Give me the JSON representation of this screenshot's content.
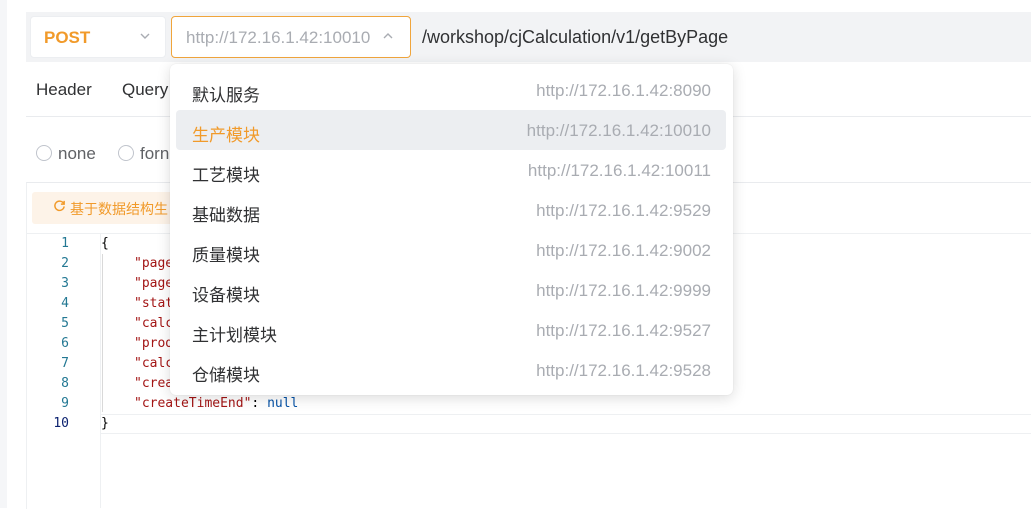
{
  "request": {
    "method": "POST",
    "server_url": "http://172.16.1.42:10010",
    "path": "/workshop/cjCalculation/v1/getByPage"
  },
  "tabs": [
    "Header",
    "Query"
  ],
  "body_types": [
    "none",
    "forn"
  ],
  "editor": {
    "generate_button": "基于数据结构生",
    "line_numbers": [
      "1",
      "2",
      "3",
      "4",
      "5",
      "6",
      "7",
      "8",
      "9",
      "10"
    ],
    "lines": [
      {
        "text": "{"
      },
      {
        "key": "\"page"
      },
      {
        "key": "\"page"
      },
      {
        "key": "\"stat"
      },
      {
        "key": "\"calc"
      },
      {
        "key": "\"prod"
      },
      {
        "key": "\"calc"
      },
      {
        "key": "\"crea"
      },
      {
        "key": "\"createTimeEnd\"",
        "sep": ": ",
        "value": "null"
      },
      {
        "text": "}"
      }
    ]
  },
  "dropdown": {
    "selected_index": 1,
    "options": [
      {
        "name": "默认服务",
        "url": "http://172.16.1.42:8090"
      },
      {
        "name": "生产模块",
        "url": "http://172.16.1.42:10010"
      },
      {
        "name": "工艺模块",
        "url": "http://172.16.1.42:10011"
      },
      {
        "name": "基础数据",
        "url": "http://172.16.1.42:9529"
      },
      {
        "name": "质量模块",
        "url": "http://172.16.1.42:9002"
      },
      {
        "name": "设备模块",
        "url": "http://172.16.1.42:9999"
      },
      {
        "name": "主计划模块",
        "url": "http://172.16.1.42:9527"
      },
      {
        "name": "仓储模块",
        "url": "http://172.16.1.42:9528"
      }
    ]
  },
  "colors": {
    "accent": "#f19a2a",
    "muted_text": "#a9acb2",
    "selected_bg": "#eceef1"
  },
  "icons": {
    "method_chevron": "chevron-down-icon",
    "server_chevron": "chevron-up-icon",
    "generate": "refresh-icon"
  }
}
